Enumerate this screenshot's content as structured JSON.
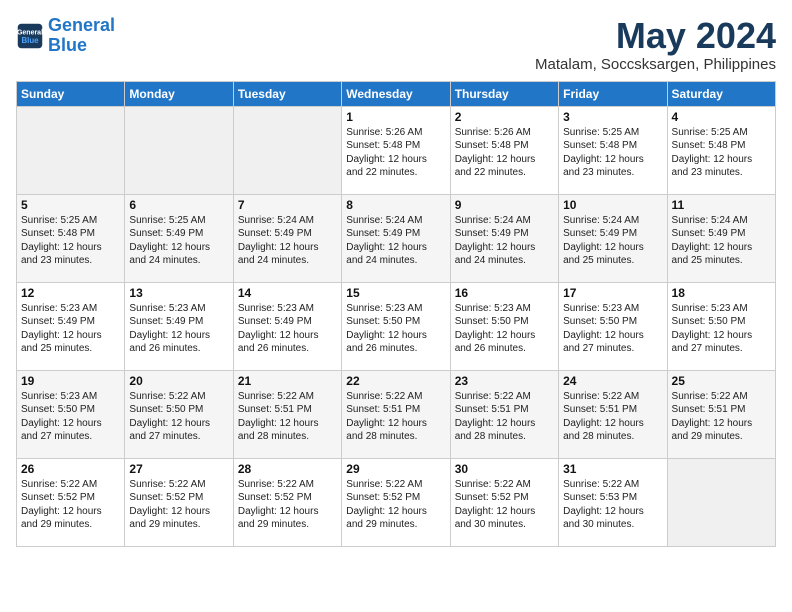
{
  "header": {
    "logo_line1": "General",
    "logo_line2": "Blue",
    "month_year": "May 2024",
    "location": "Matalam, Soccsksargen, Philippines"
  },
  "weekdays": [
    "Sunday",
    "Monday",
    "Tuesday",
    "Wednesday",
    "Thursday",
    "Friday",
    "Saturday"
  ],
  "weeks": [
    [
      {
        "day": "",
        "info": ""
      },
      {
        "day": "",
        "info": ""
      },
      {
        "day": "",
        "info": ""
      },
      {
        "day": "1",
        "info": "Sunrise: 5:26 AM\nSunset: 5:48 PM\nDaylight: 12 hours and 22 minutes."
      },
      {
        "day": "2",
        "info": "Sunrise: 5:26 AM\nSunset: 5:48 PM\nDaylight: 12 hours and 22 minutes."
      },
      {
        "day": "3",
        "info": "Sunrise: 5:25 AM\nSunset: 5:48 PM\nDaylight: 12 hours and 23 minutes."
      },
      {
        "day": "4",
        "info": "Sunrise: 5:25 AM\nSunset: 5:48 PM\nDaylight: 12 hours and 23 minutes."
      }
    ],
    [
      {
        "day": "5",
        "info": "Sunrise: 5:25 AM\nSunset: 5:48 PM\nDaylight: 12 hours and 23 minutes."
      },
      {
        "day": "6",
        "info": "Sunrise: 5:25 AM\nSunset: 5:49 PM\nDaylight: 12 hours and 24 minutes."
      },
      {
        "day": "7",
        "info": "Sunrise: 5:24 AM\nSunset: 5:49 PM\nDaylight: 12 hours and 24 minutes."
      },
      {
        "day": "8",
        "info": "Sunrise: 5:24 AM\nSunset: 5:49 PM\nDaylight: 12 hours and 24 minutes."
      },
      {
        "day": "9",
        "info": "Sunrise: 5:24 AM\nSunset: 5:49 PM\nDaylight: 12 hours and 24 minutes."
      },
      {
        "day": "10",
        "info": "Sunrise: 5:24 AM\nSunset: 5:49 PM\nDaylight: 12 hours and 25 minutes."
      },
      {
        "day": "11",
        "info": "Sunrise: 5:24 AM\nSunset: 5:49 PM\nDaylight: 12 hours and 25 minutes."
      }
    ],
    [
      {
        "day": "12",
        "info": "Sunrise: 5:23 AM\nSunset: 5:49 PM\nDaylight: 12 hours and 25 minutes."
      },
      {
        "day": "13",
        "info": "Sunrise: 5:23 AM\nSunset: 5:49 PM\nDaylight: 12 hours and 26 minutes."
      },
      {
        "day": "14",
        "info": "Sunrise: 5:23 AM\nSunset: 5:49 PM\nDaylight: 12 hours and 26 minutes."
      },
      {
        "day": "15",
        "info": "Sunrise: 5:23 AM\nSunset: 5:50 PM\nDaylight: 12 hours and 26 minutes."
      },
      {
        "day": "16",
        "info": "Sunrise: 5:23 AM\nSunset: 5:50 PM\nDaylight: 12 hours and 26 minutes."
      },
      {
        "day": "17",
        "info": "Sunrise: 5:23 AM\nSunset: 5:50 PM\nDaylight: 12 hours and 27 minutes."
      },
      {
        "day": "18",
        "info": "Sunrise: 5:23 AM\nSunset: 5:50 PM\nDaylight: 12 hours and 27 minutes."
      }
    ],
    [
      {
        "day": "19",
        "info": "Sunrise: 5:23 AM\nSunset: 5:50 PM\nDaylight: 12 hours and 27 minutes."
      },
      {
        "day": "20",
        "info": "Sunrise: 5:22 AM\nSunset: 5:50 PM\nDaylight: 12 hours and 27 minutes."
      },
      {
        "day": "21",
        "info": "Sunrise: 5:22 AM\nSunset: 5:51 PM\nDaylight: 12 hours and 28 minutes."
      },
      {
        "day": "22",
        "info": "Sunrise: 5:22 AM\nSunset: 5:51 PM\nDaylight: 12 hours and 28 minutes."
      },
      {
        "day": "23",
        "info": "Sunrise: 5:22 AM\nSunset: 5:51 PM\nDaylight: 12 hours and 28 minutes."
      },
      {
        "day": "24",
        "info": "Sunrise: 5:22 AM\nSunset: 5:51 PM\nDaylight: 12 hours and 28 minutes."
      },
      {
        "day": "25",
        "info": "Sunrise: 5:22 AM\nSunset: 5:51 PM\nDaylight: 12 hours and 29 minutes."
      }
    ],
    [
      {
        "day": "26",
        "info": "Sunrise: 5:22 AM\nSunset: 5:52 PM\nDaylight: 12 hours and 29 minutes."
      },
      {
        "day": "27",
        "info": "Sunrise: 5:22 AM\nSunset: 5:52 PM\nDaylight: 12 hours and 29 minutes."
      },
      {
        "day": "28",
        "info": "Sunrise: 5:22 AM\nSunset: 5:52 PM\nDaylight: 12 hours and 29 minutes."
      },
      {
        "day": "29",
        "info": "Sunrise: 5:22 AM\nSunset: 5:52 PM\nDaylight: 12 hours and 29 minutes."
      },
      {
        "day": "30",
        "info": "Sunrise: 5:22 AM\nSunset: 5:52 PM\nDaylight: 12 hours and 30 minutes."
      },
      {
        "day": "31",
        "info": "Sunrise: 5:22 AM\nSunset: 5:53 PM\nDaylight: 12 hours and 30 minutes."
      },
      {
        "day": "",
        "info": ""
      }
    ]
  ]
}
